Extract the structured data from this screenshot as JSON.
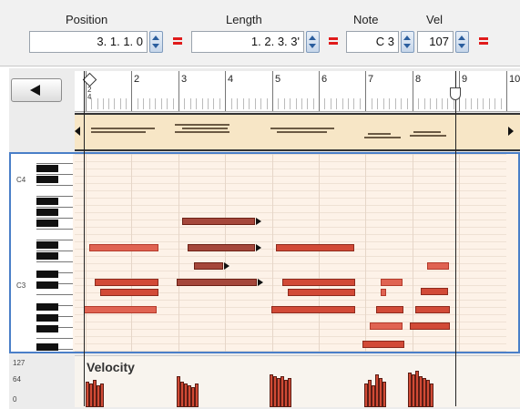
{
  "toolbar": {
    "position": {
      "label": "Position",
      "value": "3. 1. 1.    0"
    },
    "length": {
      "label": "Length",
      "value": "1. 2. 3.    3'"
    },
    "note": {
      "label": "Note",
      "value": "C 3"
    },
    "velocity": {
      "label": "Vel",
      "value": "107"
    }
  },
  "ruler": {
    "bars": [
      "2",
      "3",
      "4",
      "5",
      "6",
      "7",
      "8",
      "9",
      "10"
    ],
    "time_signature": [
      "2",
      "4"
    ]
  },
  "keyboard": {
    "labels": [
      "C4",
      "C3"
    ]
  },
  "velocity_lane": {
    "title": "Velocity",
    "scale": [
      "127",
      "64",
      "0"
    ]
  },
  "colors": {
    "note_light": "#e06352",
    "note_mid": "#d24a37",
    "note_dark": "#a5473b",
    "selection_border": "#4a7fc8",
    "link_equals": "#e01b1b"
  }
}
